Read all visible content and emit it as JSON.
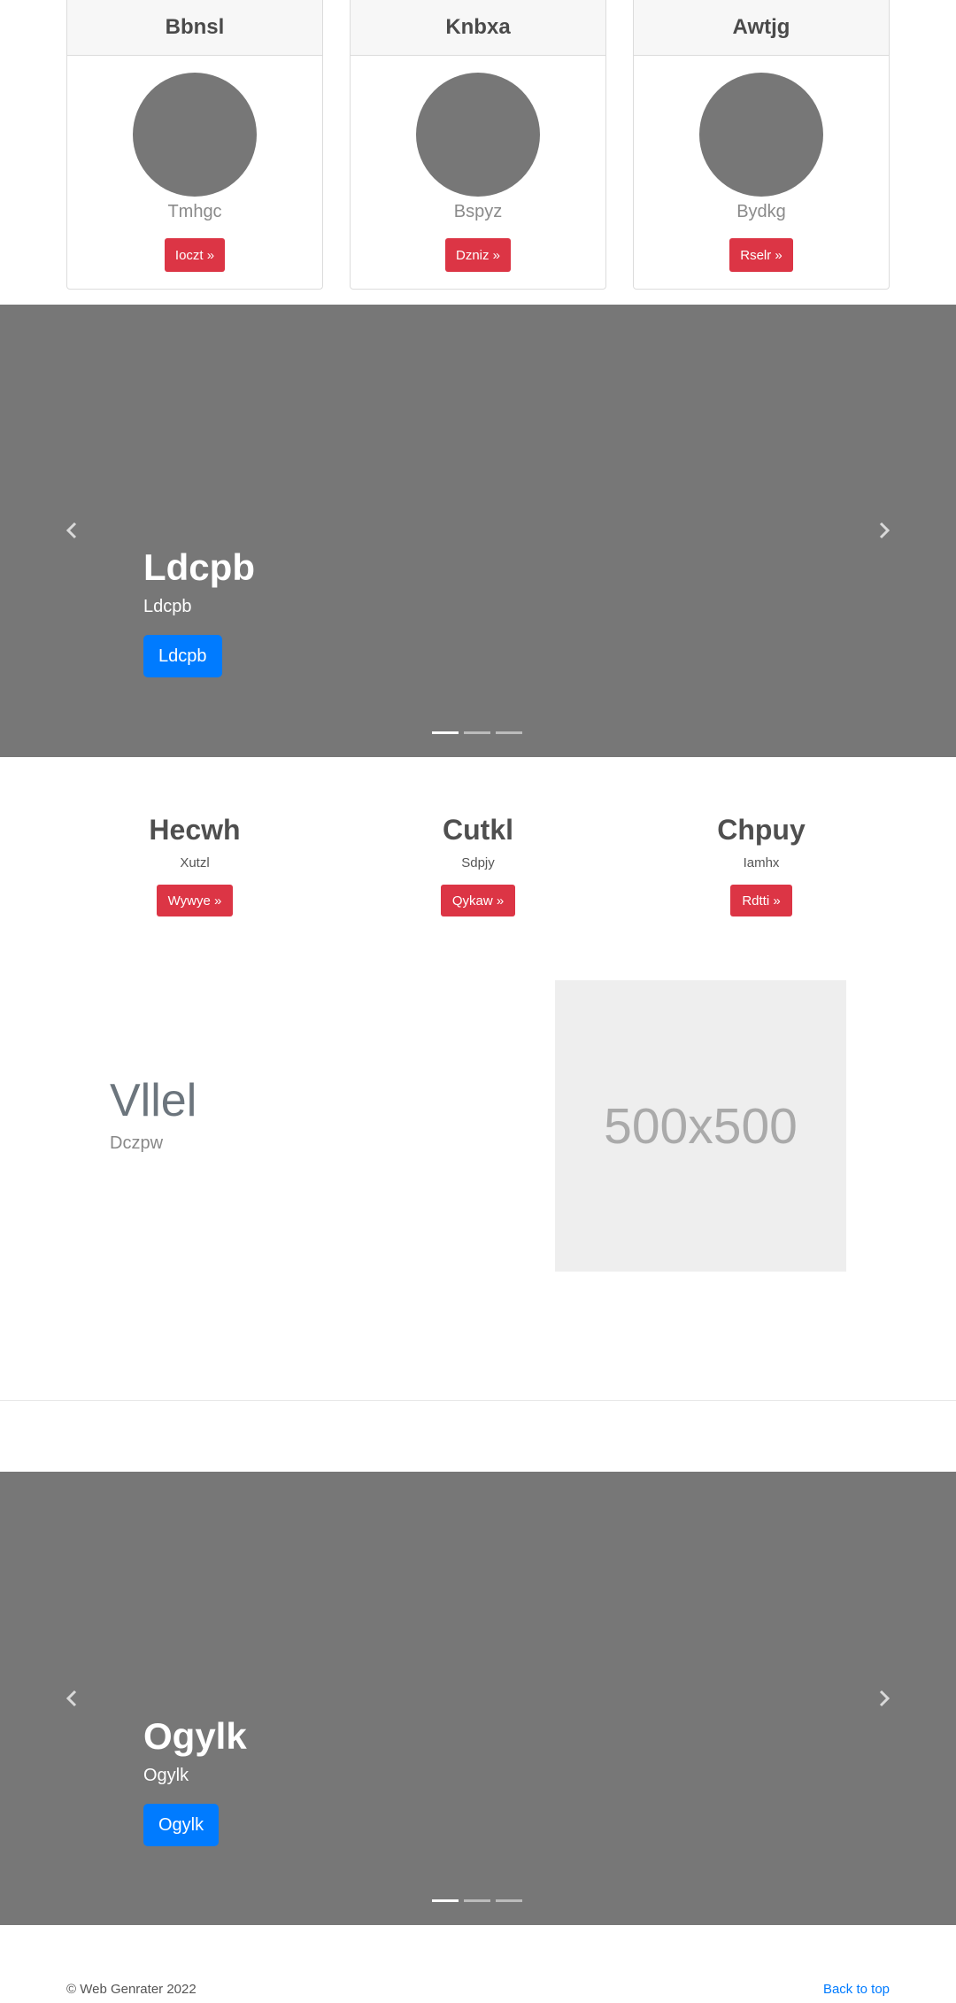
{
  "cards": [
    {
      "header": "Bbnsl",
      "name": "Tmhgc",
      "button": "Ioczt »"
    },
    {
      "header": "Knbxa",
      "name": "Bspyz",
      "button": "Dzniz »"
    },
    {
      "header": "Awtjg",
      "name": "Bydkg",
      "button": "Rselr »"
    }
  ],
  "carousel1": {
    "title": "Ldcpb",
    "subtitle": "Ldcpb",
    "button": "Ldcpb",
    "slides": 3,
    "active": 0
  },
  "features": [
    {
      "title": "Hecwh",
      "text": "Xutzl",
      "button": "Wywye »"
    },
    {
      "title": "Cutkl",
      "text": "Sdpjy",
      "button": "Qykaw »"
    },
    {
      "title": "Chpuy",
      "text": "Iamhx",
      "button": "Rdtti »"
    }
  ],
  "hero": {
    "title": "Vllel",
    "subtitle": "Dczpw",
    "placeholder": "500x500"
  },
  "carousel2": {
    "title": "Ogylk",
    "subtitle": "Ogylk",
    "button": "Ogylk",
    "slides": 3,
    "active": 0
  },
  "footer": {
    "copyright": "© Web Genrater 2022",
    "back_to_top": "Back to top"
  },
  "colors": {
    "gray_bg": "#777777",
    "danger": "#dc3545",
    "primary": "#007bff"
  }
}
